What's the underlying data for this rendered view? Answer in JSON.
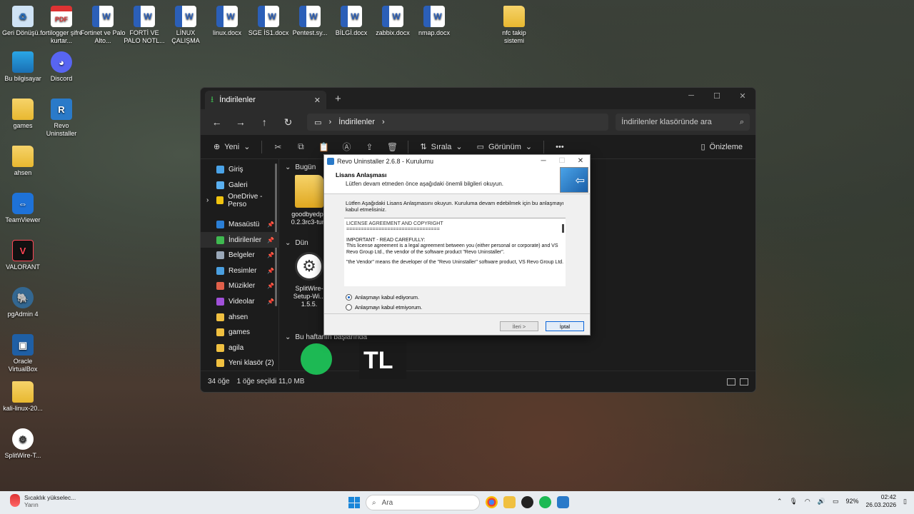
{
  "desktop_icons": [
    {
      "label": "Geri Dönüşü...",
      "type": "recycle",
      "symbol": "♻"
    },
    {
      "label": "fortilogger şifre kurtar...",
      "type": "pdf",
      "symbol": "PDF"
    },
    {
      "label": "Fortinet ve Palo Alto...",
      "type": "word",
      "symbol": "W"
    },
    {
      "label": "FORTİ VE PALO NOTL...",
      "type": "word",
      "symbol": "W"
    },
    {
      "label": "LİNUX ÇALIŞMA",
      "type": "word",
      "symbol": "W"
    },
    {
      "label": "linux.docx",
      "type": "word",
      "symbol": "W"
    },
    {
      "label": "SGE İS1.docx",
      "type": "word",
      "symbol": "W"
    },
    {
      "label": "Pentest.sy...",
      "type": "word",
      "symbol": "W"
    },
    {
      "label": "BİLGİ.docx",
      "type": "word",
      "symbol": "W"
    },
    {
      "label": "zabbix.docx",
      "type": "word",
      "symbol": "W"
    },
    {
      "label": "nmap.docx",
      "type": "word",
      "symbol": "W"
    },
    {
      "label": "nfc takip sistemi",
      "type": "folder",
      "symbol": ""
    },
    {
      "label": "Bu bilgisayar",
      "type": "pc",
      "symbol": ""
    },
    {
      "label": "Discord",
      "type": "discord",
      "symbol": "◕"
    },
    {
      "label": "games",
      "type": "folder",
      "symbol": ""
    },
    {
      "label": "Revo Uninstaller",
      "type": "revo",
      "symbol": "R"
    },
    {
      "label": "ahsen",
      "type": "folder",
      "symbol": ""
    },
    {
      "label": "TeamViewer",
      "type": "team",
      "symbol": "⇔"
    },
    {
      "label": "VALORANT",
      "type": "valo",
      "symbol": "V"
    },
    {
      "label": "pgAdmin 4",
      "type": "pg",
      "symbol": "🐘"
    },
    {
      "label": "Oracle VirtualBox",
      "type": "vbox",
      "symbol": "▣"
    },
    {
      "label": "kali-linux-20...",
      "type": "folder",
      "symbol": ""
    },
    {
      "label": "SplitWire-T...",
      "type": "split",
      "symbol": "⚙"
    }
  ],
  "explorer": {
    "tab_title": "İndirilenler",
    "breadcrumb": "İndirilenler",
    "search_placeholder": "İndirilenler klasöründe ara",
    "toolbar": {
      "new": "Yeni",
      "sort": "Sırala",
      "view": "Görünüm",
      "more": "•••",
      "preview": "Önizleme"
    },
    "sidebar": [
      {
        "label": "Giriş",
        "color": "#4aa3e8",
        "pin": false
      },
      {
        "label": "Galeri",
        "color": "#5ab0f0",
        "pin": false
      },
      {
        "label": "OneDrive - Perso",
        "color": "#f1c40f",
        "pin": false,
        "expand": true
      },
      {
        "gap": true
      },
      {
        "label": "Masaüstü",
        "color": "#2b7fd6",
        "pin": true
      },
      {
        "label": "İndirilenler",
        "color": "#3fb950",
        "pin": true,
        "active": true
      },
      {
        "label": "Belgeler",
        "color": "#9aa8b8",
        "pin": true
      },
      {
        "label": "Resimler",
        "color": "#4a9fe0",
        "pin": true
      },
      {
        "label": "Müzikler",
        "color": "#e0604a",
        "pin": true
      },
      {
        "label": "Videolar",
        "color": "#a050d8",
        "pin": true
      },
      {
        "label": "ahsen",
        "color": "#f0c040",
        "pin": false
      },
      {
        "label": "games",
        "color": "#f0c040",
        "pin": false
      },
      {
        "label": "agila",
        "color": "#f0c040",
        "pin": false
      },
      {
        "label": "Yeni klasör (2)",
        "color": "#f0c040",
        "pin": false
      }
    ],
    "groups": {
      "today": "Bugün",
      "yesterday": "Dün",
      "this_week": "Bu haftanın başlarında"
    },
    "files": [
      {
        "label": "goodbyedpi-0.2.3rc3-turk",
        "kind": "zip"
      },
      {
        "label": "SplitWire-Setup-Wi... 1.5.5.",
        "kind": "setup"
      }
    ],
    "status": {
      "count": "34 öğe",
      "selected": "1 öğe seçildi  11,0 MB"
    }
  },
  "dialog": {
    "title": "Revo Uninstaller 2.6.8 - Kurulumu",
    "header_title": "Lisans Anlaşması",
    "header_sub": "Lütfen devam etmeden önce aşağıdaki önemli bilgileri okuyun.",
    "intro": "Lütfen Aşağıdaki Lisans Anlaşmasını okuyun. Kuruluma devam edebilmek için bu anlaşmayı kabul etmelisiniz.",
    "license": [
      "LICENSE AGREEMENT AND COPYRIGHT\n================================",
      "IMPORTANT - READ CAREFULLY:\nThis license agreement is a legal agreement between you (either personal or corporate) and VS Revo Group Ltd., the vendor of the software product \"Revo Uninstaller\".",
      "\"the Vendor\" means the developer of the \"Revo Uninstaller\" software product, VS Revo Group Ltd."
    ],
    "accept": "Anlaşmayı kabul ediyorum.",
    "decline": "Anlaşmayı kabul etmiyorum.",
    "next": "İleri >",
    "cancel": "İptal"
  },
  "taskbar": {
    "weather_title": "Sıcaklık yükselec...",
    "weather_sub": "Yarın",
    "search": "Ara",
    "battery": "92%",
    "time": "02:42",
    "date": "26.03.2026"
  }
}
